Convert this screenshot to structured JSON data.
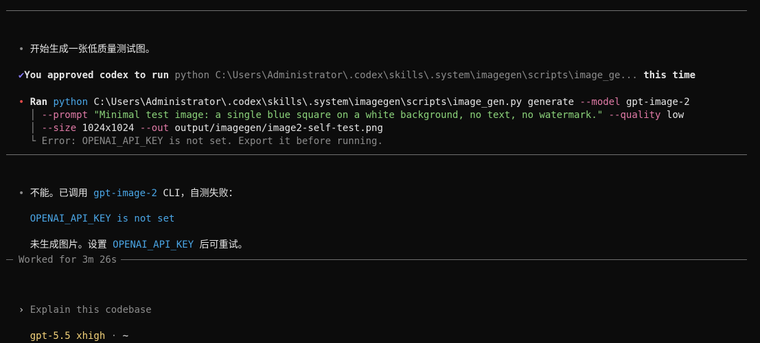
{
  "messages": {
    "status1": "开始生成一张低质量测试图。",
    "approval": {
      "check": "✔",
      "prefix": "You approved codex to run",
      "command": "python C:\\Users\\Administrator\\.codex\\skills\\.system\\imagegen\\scripts\\image_ge...",
      "suffix": "this time"
    },
    "ran": {
      "dot": "•",
      "label": "Ran",
      "cmd": "python",
      "path": "C:\\Users\\Administrator\\.codex\\skills\\.system\\imagegen\\scripts\\image_gen.py",
      "sub": "generate",
      "model_flag": "--model",
      "model_val": "gpt-image-2",
      "prompt_flag": "--prompt",
      "prompt_val": "\"Minimal test image: a single blue square on a white background, no text, no watermark.\"",
      "quality_flag": "--quality",
      "quality_val": "low",
      "size_flag": "--size",
      "size_val": "1024x1024",
      "out_flag": "--out",
      "out_val": "output/imagegen/image2-self-test.png",
      "error": "Error: OPENAI_API_KEY is not set. Export it before running."
    },
    "reply": {
      "line1_a": "不能。已调用",
      "line1_code": "gpt-image-2",
      "line1_b": "CLI，自测失败：",
      "error_code": "OPENAI_API_KEY is not set",
      "line3_a": "未生成图片。设置",
      "line3_code": "OPENAI_API_KEY",
      "line3_b": "后可重试。"
    },
    "worked": "Worked for 3m 26s"
  },
  "input": {
    "caret": "›",
    "placeholder": "Explain this codebase"
  },
  "footer": {
    "model": "gpt-5.5 xhigh",
    "sep": "·",
    "dir": "~"
  }
}
